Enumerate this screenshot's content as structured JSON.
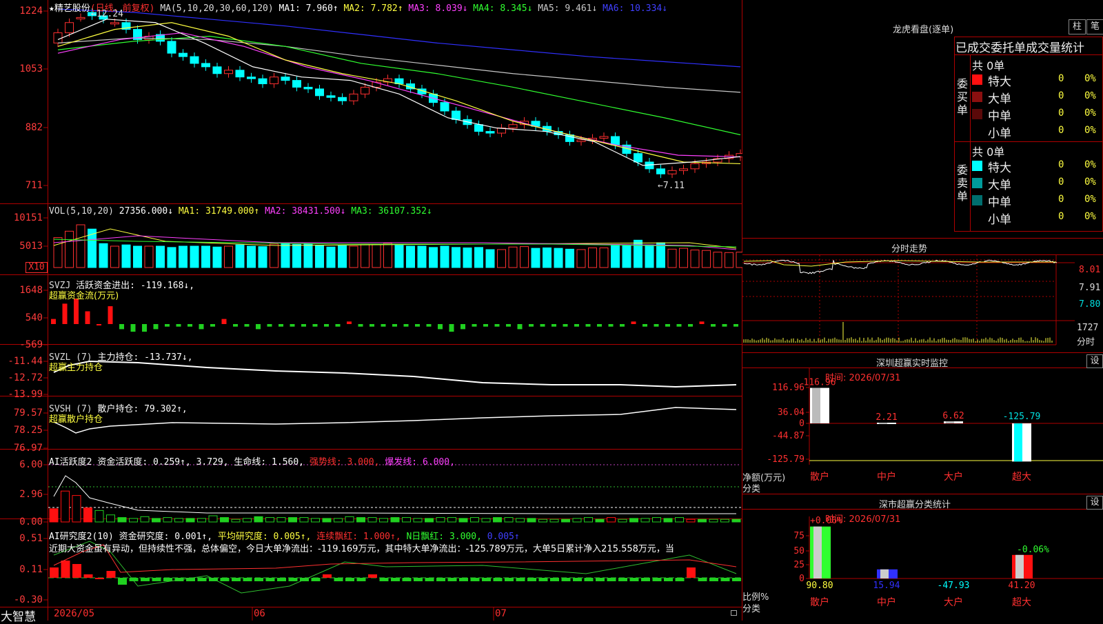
{
  "chart_header": {
    "title_star": "★",
    "stock_name": "精艺股份",
    "period_note": "(日线，前复权)",
    "ma_label": "MA(5,10,20,30,60,120)",
    "ma1": "MA1: 7.960↑",
    "ma2": "MA2: 7.782↑",
    "ma3": "MA3: 8.039↓",
    "ma4": "MA4: 8.345↓",
    "ma5": "MA5: 9.461↓",
    "ma6": "MA6: 10.334↓",
    "high_marker": "12.24",
    "low_marker": "7.11"
  },
  "price_axis": [
    "1224",
    "1053",
    "882",
    "711"
  ],
  "volume": {
    "header": "VOL(5,10,20)",
    "value": "27356.000↓",
    "ma1": "MA1: 31749.000↑",
    "ma2": "MA2: 38431.500↓",
    "ma3": "MA3: 36107.352↓",
    "axis": [
      "10151",
      "5013"
    ],
    "unit": "X10"
  },
  "svzj": {
    "name": "SVZJ",
    "label": "活跃资金进出: -119.168↓,",
    "title": "超赢资金流(万元)",
    "axis": [
      "1648",
      "540",
      "-569"
    ]
  },
  "svzl": {
    "name": "SVZL (7)",
    "label": "主力持仓: -13.737↓,",
    "title": "超赢主力持仓",
    "axis": [
      "-11.44",
      "-12.72",
      "-13.99"
    ]
  },
  "svsh": {
    "name": "SVSH (7)",
    "label": "散户持仓: 79.302↑,",
    "title": "超赢散户持仓",
    "axis": [
      "79.57",
      "78.25",
      "76.97"
    ]
  },
  "ai_active": {
    "name": "AI活跃度2",
    "l1": "资金活跃度: 0.259↑",
    "l2": ", 3.729,",
    "l3": "生命线: 1.560,",
    "l4": "强势线: 3.000,",
    "l5": "爆发线: 6.000,",
    "axis": [
      "6.00",
      "2.96",
      "0.00"
    ]
  },
  "ai_research": {
    "name": "AI研究度2(10)",
    "l1": "资金研究度: 0.001↑,",
    "l2": "平均研究度: 0.005↑,",
    "l3": "连续飘红: 1.000↑,",
    "l4": "N日飘红: 3.000,",
    "l5": "0.005↑",
    "text": "近期大资金虽有异动，但持续性不强，总体偏空，今日大单净流出：-119.169万元，其中特大单净流出：-125.789万元，大单5日累计净入215.558万元，当",
    "axis": [
      "0.51",
      "0.11",
      "-0.30"
    ]
  },
  "date_axis": [
    "2026/05",
    "06",
    "07"
  ],
  "brand": "大智慧",
  "dragon_tiger": {
    "title": "龙虎看盘(逐单)",
    "btn_bar": "柱",
    "btn_pen": "笔",
    "subtitle": "已成交委托单成交量统计",
    "buy_group": "委买单",
    "sell_group": "委卖单",
    "buy_total": "共 0单",
    "sell_total": "共 0单",
    "buy_rows": [
      {
        "label": "特大",
        "count": "0",
        "pct": "0%",
        "color": "#ff1010"
      },
      {
        "label": "大单",
        "count": "0",
        "pct": "0%",
        "color": "#8b0f0f"
      },
      {
        "label": "中单",
        "count": "0",
        "pct": "0%",
        "color": "#5a0909"
      },
      {
        "label": "小单",
        "count": "0",
        "pct": "0%",
        "color": "#000000"
      }
    ],
    "sell_rows": [
      {
        "label": "特大",
        "count": "0",
        "pct": "0%",
        "color": "#00ffff"
      },
      {
        "label": "大单",
        "count": "0",
        "pct": "0%",
        "color": "#009b9b"
      },
      {
        "label": "中单",
        "count": "0",
        "pct": "0%",
        "color": "#006e6e"
      },
      {
        "label": "小单",
        "count": "0",
        "pct": "0%",
        "color": "#000000"
      }
    ]
  },
  "intraday": {
    "title": "分时走势",
    "axis": [
      "8.01",
      "7.91",
      "7.80"
    ],
    "vol_label": "1727",
    "vol_unit": "分时"
  },
  "monitor": {
    "title": "深圳超赢实时监控",
    "set_btn": "设",
    "time": "时间: 2026/07/31",
    "axis": [
      "116.96",
      "36.04",
      "0",
      "-44.87",
      "-125.79"
    ],
    "ylabel": "净额(万元)",
    "xlabel": "分类",
    "categories": [
      "散户",
      "中户",
      "大户",
      "超大"
    ],
    "values": [
      "116.96",
      "2.21",
      "6.62",
      "-125.79"
    ]
  },
  "classify": {
    "title": "深市超赢分类统计",
    "set_btn": "设",
    "time": "时间: 2026/07/31",
    "axis": [
      "75",
      "50",
      "25",
      "0"
    ],
    "ylabel": "比例%",
    "xlabel": "分类",
    "categories": [
      "散户",
      "中户",
      "大户",
      "超大"
    ],
    "values": [
      "90.80",
      "15.94",
      "-47.93",
      "41.20"
    ],
    "top_labels": [
      "+0.06%",
      "-0.06%"
    ]
  }
}
